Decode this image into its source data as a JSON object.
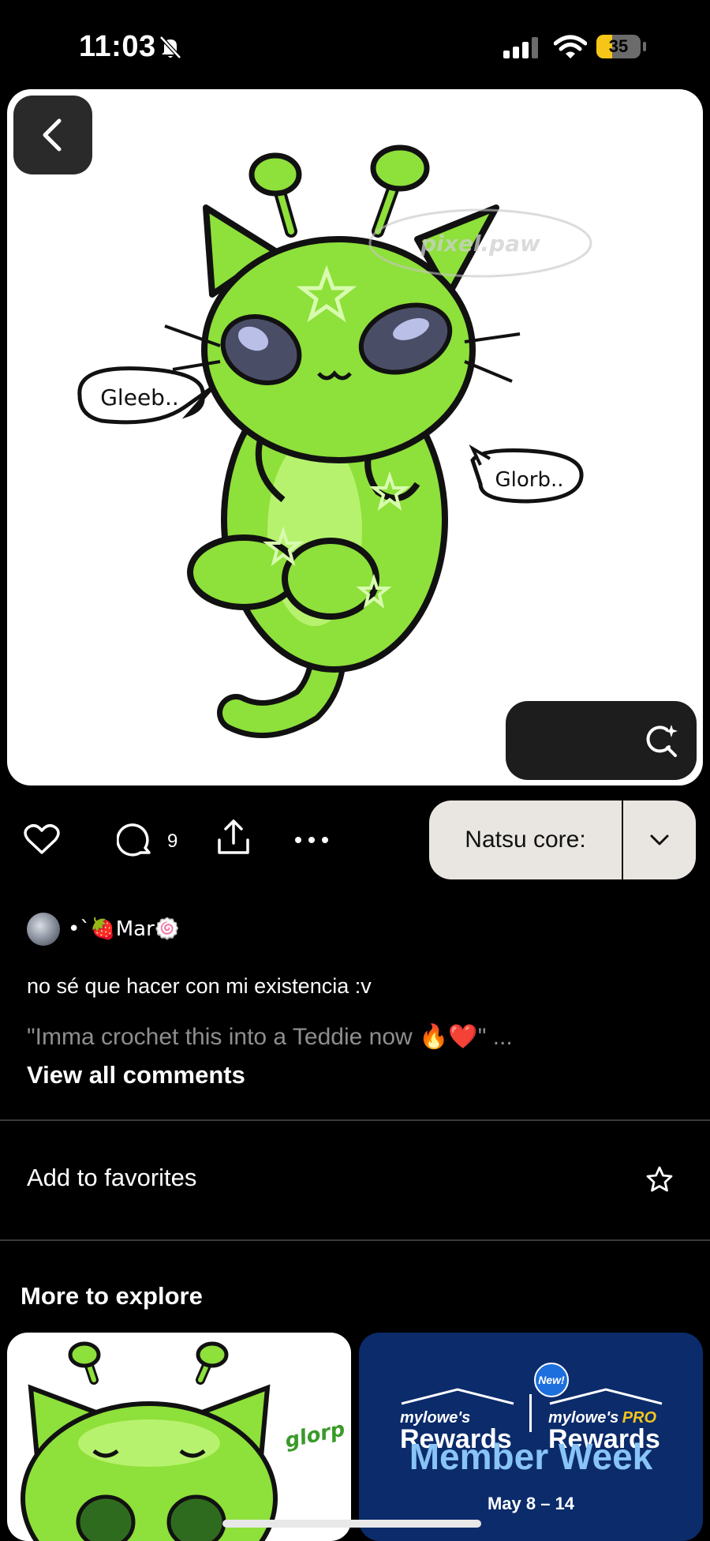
{
  "status_bar": {
    "time": "11:03",
    "battery_level": "35",
    "battery_fraction": 0.35
  },
  "pin": {
    "speech_bubble_left": "Gleeb..",
    "speech_bubble_right": "Glorb..",
    "watermark": "pixel.paw"
  },
  "actions": {
    "comment_count": "9",
    "board_name": "Natsu core:"
  },
  "author": {
    "name": "•`🍓Mar🍥"
  },
  "description": "no sé que hacer con mi existencia :v",
  "comment_preview": "\"Imma crochet this into a Teddie now 🔥❤️\" ...",
  "view_all_comments": "View all comments",
  "favorites_label": "Add to favorites",
  "more_to_explore": "More to explore",
  "explore_cards": [
    {
      "label": "glorp"
    },
    {
      "brand_small": "mylowe's",
      "brand_big": "Rewards",
      "pro_small": "mylowe's",
      "pro_tag": "PRO",
      "pro_big": "Rewards",
      "new_badge": "New!",
      "headline": "Member Week",
      "dates": "May 8 – 14"
    }
  ],
  "colors": {
    "lowes_blue": "#0b2b6b",
    "alien_green": "#8ee03a",
    "battery_yellow": "#f5c518"
  }
}
